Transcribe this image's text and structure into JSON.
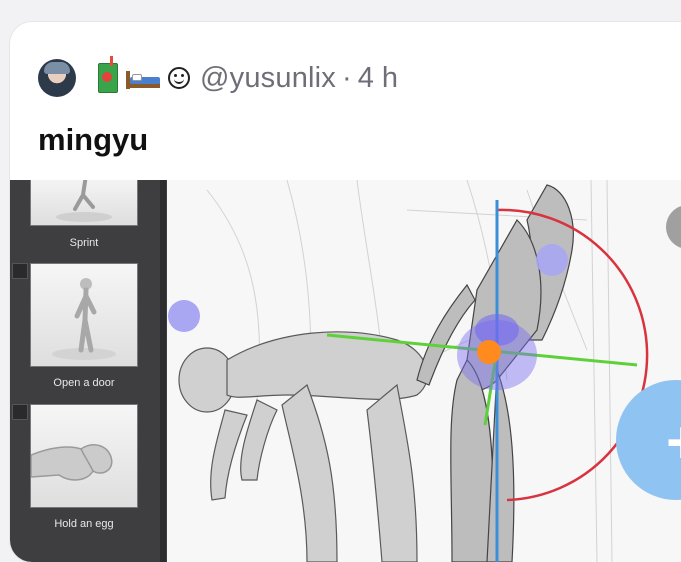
{
  "post": {
    "handle": "@yusunlix",
    "separator": "·",
    "time": "4 h",
    "text": "mingyu"
  },
  "header_icons": [
    "avatar",
    "juice-box-icon",
    "bed-icon",
    "smiley-icon"
  ],
  "pose_library": {
    "items": [
      {
        "label": "Sprint"
      },
      {
        "label": "Open a door"
      },
      {
        "label": "Hold an egg"
      }
    ]
  },
  "colors": {
    "card_bg": "#ffffff",
    "meta_text": "#6e6e78",
    "panel_bg": "#3e3e40",
    "fab": "#8fc4f2",
    "gizmo_red": "#d8333f",
    "gizmo_green": "#5ed13a",
    "gizmo_blue": "#3b8fd8",
    "gizmo_joint": "#ff8a1e",
    "gizmo_handle": "#8a7cf0"
  }
}
